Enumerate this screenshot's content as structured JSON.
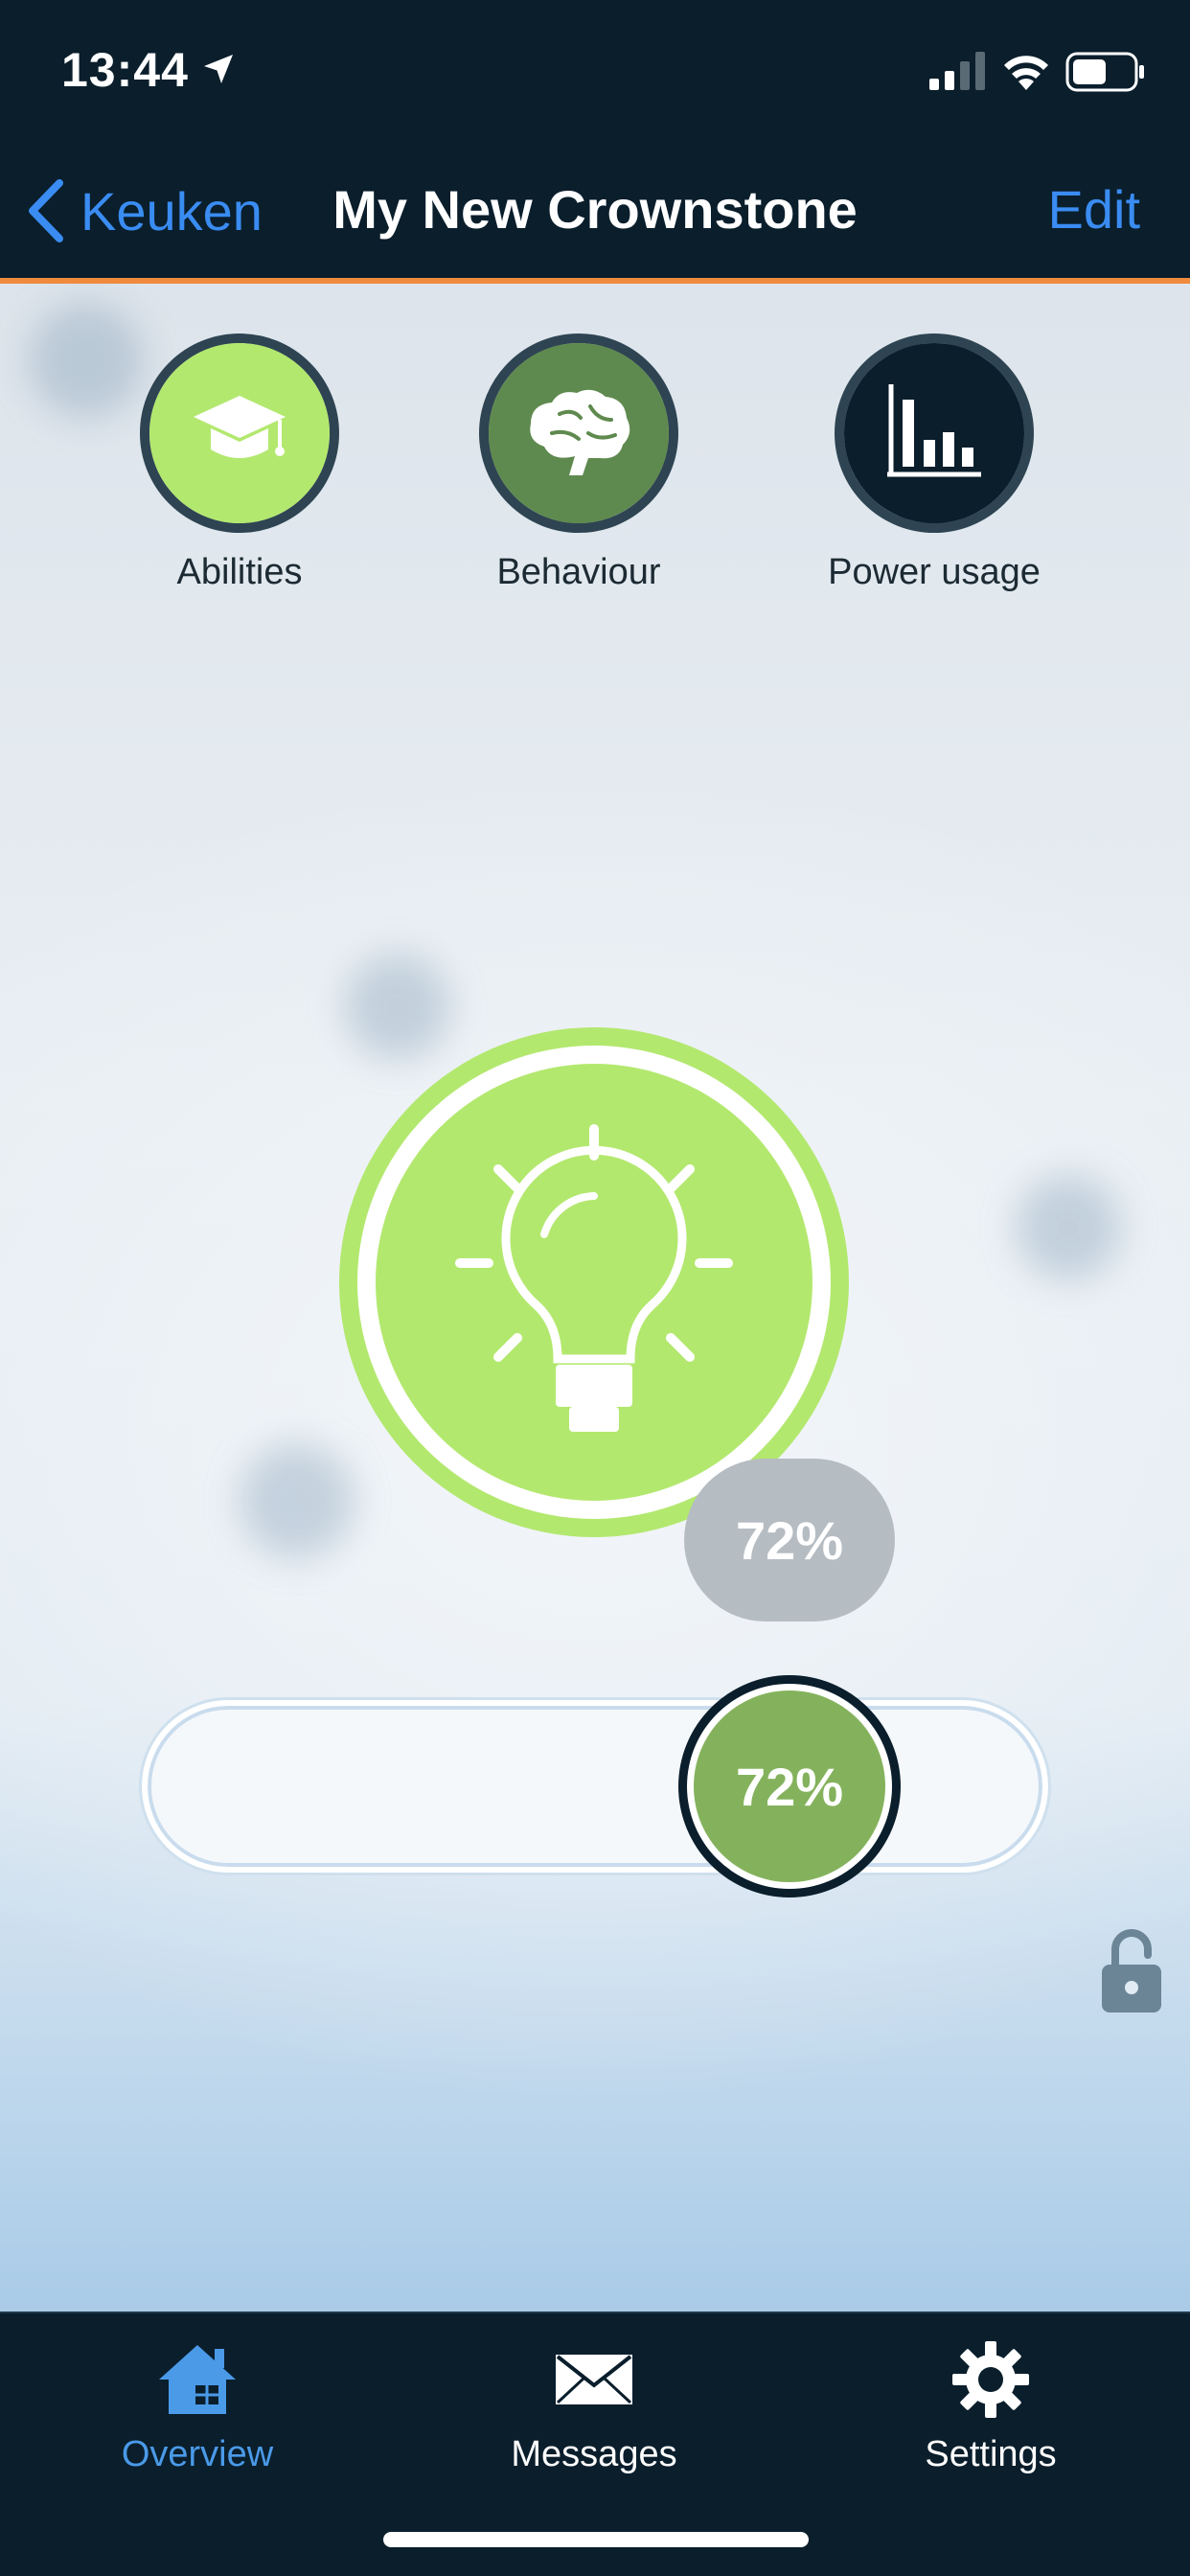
{
  "status_bar": {
    "time": "13:44",
    "icons": [
      "location-arrow-icon",
      "signal-icon",
      "wifi-icon",
      "battery-icon"
    ]
  },
  "nav": {
    "back_label": "Keuken",
    "title": "My New Crownstone",
    "edit_label": "Edit"
  },
  "features": [
    {
      "label": "Abilities",
      "icon": "graduation-cap-icon",
      "color": "#b3e86f"
    },
    {
      "label": "Behaviour",
      "icon": "brain-icon",
      "color": "#5f8a4f"
    },
    {
      "label": "Power usage",
      "icon": "bar-chart-icon",
      "color": "#0a1e2c"
    }
  ],
  "switch": {
    "icon": "lightbulb-icon",
    "state": "on",
    "color": "#b3e86f"
  },
  "dimmer": {
    "bubble_label": "72%",
    "knob_label": "72%",
    "value_percent": 72,
    "knob_color": "#84b25c"
  },
  "tabbar": {
    "tabs": [
      {
        "label": "Overview",
        "icon": "home-icon",
        "active": true
      },
      {
        "label": "Messages",
        "icon": "envelope-icon",
        "active": false
      },
      {
        "label": "Settings",
        "icon": "gear-icon",
        "active": false
      }
    ]
  },
  "colors": {
    "navbar_bg": "#0a1e2c",
    "accent_blue": "#3a8cf2",
    "accent_orange": "#f08a3c",
    "active_tab": "#4a9ae8"
  }
}
